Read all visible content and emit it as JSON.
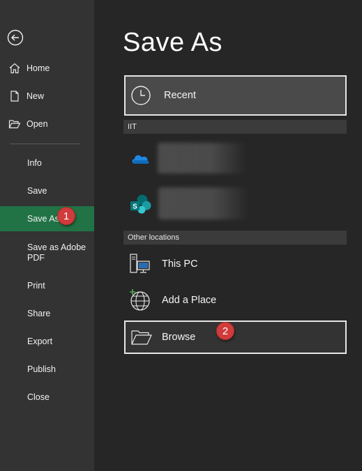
{
  "sidebar": {
    "back_icon": "back-arrow-icon",
    "items": [
      {
        "label": "Home",
        "icon": "home-icon"
      },
      {
        "label": "New",
        "icon": "new-document-icon"
      },
      {
        "label": "Open",
        "icon": "open-folder-icon"
      },
      {
        "label": "Info"
      },
      {
        "label": "Save"
      },
      {
        "label": "Save As"
      },
      {
        "label": "Save as Adobe PDF"
      },
      {
        "label": "Print"
      },
      {
        "label": "Share"
      },
      {
        "label": "Export"
      },
      {
        "label": "Publish"
      },
      {
        "label": "Close"
      }
    ],
    "active_color": "#217346"
  },
  "main": {
    "title": "Save As",
    "recent": {
      "label": "Recent",
      "icon": "clock-icon"
    },
    "group1_header": "IIT",
    "group1_items": [
      {
        "icon": "onedrive-icon"
      },
      {
        "icon": "sharepoint-icon"
      }
    ],
    "group2_header": "Other locations",
    "this_pc": {
      "label": "This PC",
      "icon": "computer-icon"
    },
    "add_place": {
      "label": "Add a Place",
      "icon": "globe-add-icon"
    },
    "browse": {
      "label": "Browse",
      "icon": "folder-icon"
    }
  },
  "annotations": {
    "badge1": "1",
    "badge2": "2",
    "badge_color": "#d03b3b"
  }
}
